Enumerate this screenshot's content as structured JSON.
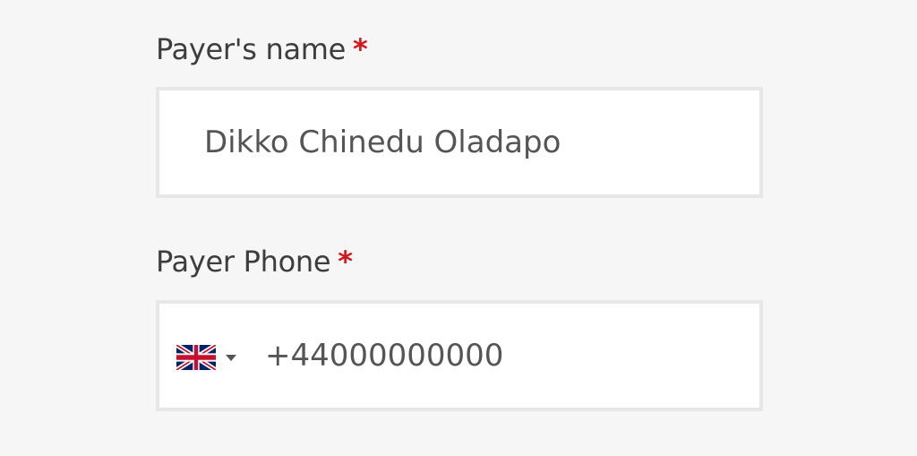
{
  "form": {
    "payer_name": {
      "label": "Payer's name",
      "required_marker": "*",
      "value": "Dikko Chinedu Oladapo"
    },
    "payer_phone": {
      "label": "Payer Phone",
      "required_marker": "*",
      "country_flag": "uk-flag-icon",
      "value": "+44000000000"
    }
  },
  "colors": {
    "background": "#f6f6f6",
    "required": "#d8141c",
    "label": "#3d3d3d",
    "input_text": "#555555",
    "input_border": "#e7e7e7"
  }
}
